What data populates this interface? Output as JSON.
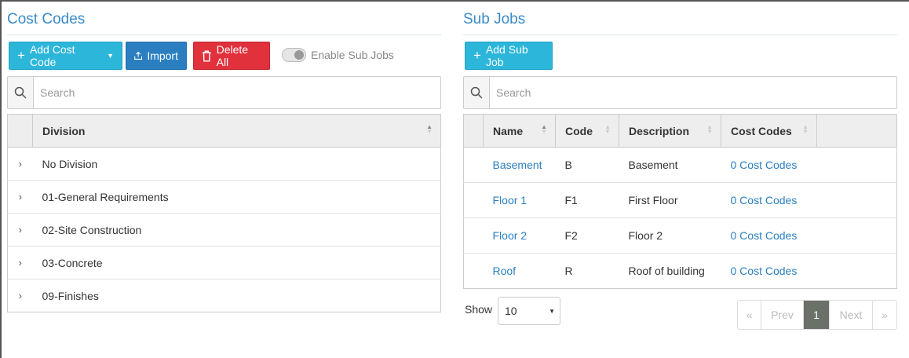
{
  "cost_codes": {
    "title": "Cost Codes",
    "add_label": "Add Cost Code",
    "import_label": "Import",
    "delete_label": "Delete All",
    "enable_sub_jobs_label": "Enable Sub Jobs",
    "enable_sub_jobs_on": false,
    "search_placeholder": "Search",
    "column_header": "Division",
    "divisions": [
      "No Division",
      "01-General Requirements",
      "02-Site Construction",
      "03-Concrete",
      "09-Finishes"
    ]
  },
  "sub_jobs": {
    "title": "Sub Jobs",
    "add_label": "Add Sub Job",
    "search_placeholder": "Search",
    "columns": [
      "Name",
      "Code",
      "Description",
      "Cost Codes"
    ],
    "rows": [
      {
        "name": "Basement",
        "code": "B",
        "description": "Basement",
        "cost_codes": "0 Cost Codes"
      },
      {
        "name": "Floor 1",
        "code": "F1",
        "description": "First Floor",
        "cost_codes": "0 Cost Codes"
      },
      {
        "name": "Floor 2",
        "code": "F2",
        "description": "Floor 2",
        "cost_codes": "0 Cost Codes"
      },
      {
        "name": "Roof",
        "code": "R",
        "description": "Roof of building",
        "cost_codes": "0 Cost Codes"
      }
    ],
    "show_label": "Show",
    "page_size": "10",
    "pagination": {
      "first": "«",
      "prev": "Prev",
      "current": "1",
      "next": "Next",
      "last": "»"
    }
  },
  "colors": {
    "accent": "#3a8bc8",
    "cyan": "#2cb6d9",
    "blue": "#2b7fc0",
    "red": "#e0313c"
  }
}
